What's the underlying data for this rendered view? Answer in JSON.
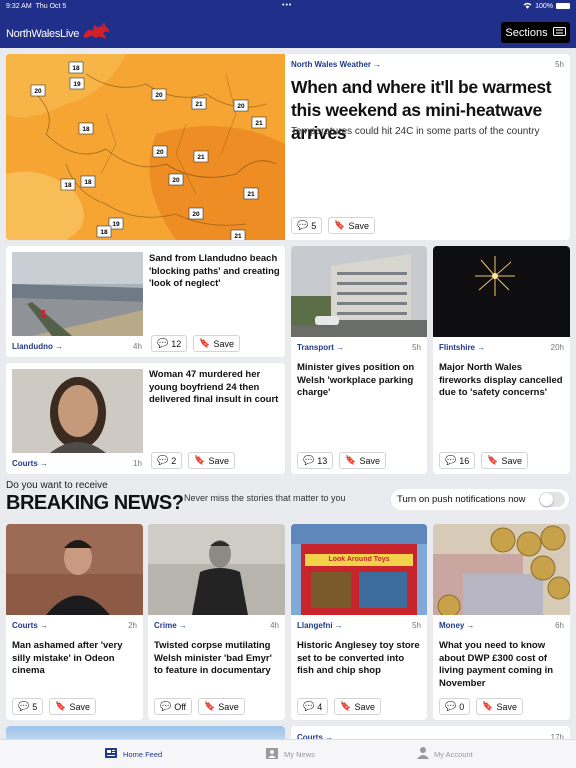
{
  "status": {
    "time": "9:32 AM",
    "date": "Thu Oct 5",
    "battery": "100%"
  },
  "header": {
    "logo_text": "NorthWalesLive",
    "sections_label": "Sections"
  },
  "lead": {
    "category": "North Wales Weather",
    "time": "5h",
    "headline": "When and where it'll be warmest this weekend as mini-heatwave arrives",
    "standfirst": "Temperatures could hit 24C in some parts of the country",
    "comments": "5",
    "save_label": "Save",
    "map_temps": [
      "18",
      "20",
      "19",
      "18",
      "20",
      "21",
      "20",
      "21",
      "18",
      "18",
      "20",
      "21",
      "19",
      "20",
      "18",
      "20",
      "21",
      "21"
    ]
  },
  "row1": [
    {
      "category": "Llandudno",
      "time": "4h",
      "headline": "Sand from Llandudno beach 'blocking paths' and creating 'look of neglect'",
      "comments": "12",
      "save": "Save"
    },
    {
      "category": "Courts",
      "time": "1h",
      "headline": "Woman 47 murdered her young boyfriend 24 then delivered final insult in court",
      "comments": "2",
      "save": "Save"
    },
    {
      "category": "Transport",
      "time": "5h",
      "headline": "Minister gives position on Welsh 'workplace parking charge'",
      "comments": "13",
      "save": "Save"
    },
    {
      "category": "Flintshire",
      "time": "20h",
      "headline": "Major North Wales fireworks display cancelled due to 'safety concerns'",
      "comments": "16",
      "save": "Save"
    }
  ],
  "breaking": {
    "question": "Do you want to receive",
    "title": "BREAKING NEWS?",
    "subtitle": "Never miss the stories that matter to you",
    "push_label": "Turn on push notifications now"
  },
  "row2": [
    {
      "category": "Courts",
      "time": "2h",
      "headline": "Man ashamed after 'very silly mistake' in Odeon cinema",
      "comments": "5",
      "save": "Save"
    },
    {
      "category": "Crime",
      "time": "4h",
      "headline": "Twisted corpse mutilating Welsh minister 'bad Emyr' to feature in documentary",
      "comments": "Off",
      "save": "Save"
    },
    {
      "category": "Llangefni",
      "time": "5h",
      "headline": "Historic Anglesey toy store set to be converted into fish and chip shop",
      "comments": "4",
      "save": "Save"
    },
    {
      "category": "Money",
      "time": "6h",
      "headline": "What you need to know about DWP £300 cost of living payment coming in November",
      "comments": "0",
      "save": "Save"
    }
  ],
  "row3": [
    {
      "category": "Courts",
      "time": "17h"
    }
  ],
  "shop_sign": "Look Around Toys",
  "tabs": [
    {
      "label": "Home Feed"
    },
    {
      "label": "My News"
    },
    {
      "label": "My Account"
    }
  ],
  "colors": {
    "brand": "#1f2f8a",
    "link": "#1f3a8a",
    "page": "#e9ebef"
  }
}
